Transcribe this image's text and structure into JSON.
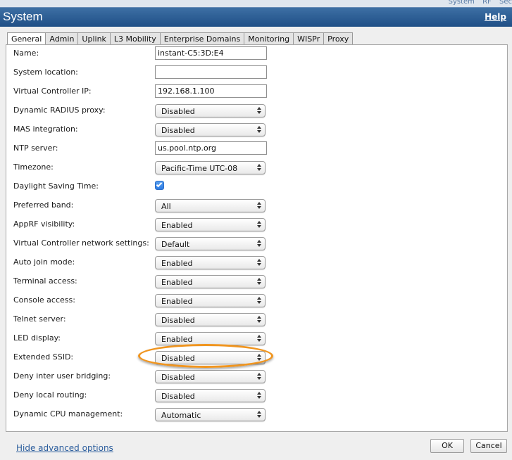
{
  "background_nav": [
    "System",
    "RF",
    "Sec"
  ],
  "window": {
    "title": "System",
    "help_link": "Help"
  },
  "tabs": [
    {
      "label": "General",
      "active": true
    },
    {
      "label": "Admin",
      "active": false
    },
    {
      "label": "Uplink",
      "active": false
    },
    {
      "label": "L3 Mobility",
      "active": false
    },
    {
      "label": "Enterprise Domains",
      "active": false
    },
    {
      "label": "Monitoring",
      "active": false
    },
    {
      "label": "WISPr",
      "active": false
    },
    {
      "label": "Proxy",
      "active": false
    }
  ],
  "form": {
    "name": {
      "label": "Name:",
      "value": "instant-C5:3D:E4"
    },
    "system_location": {
      "label": "System location:",
      "value": ""
    },
    "virtual_controller_ip": {
      "label": "Virtual Controller IP:",
      "value": "192.168.1.100"
    },
    "dynamic_radius_proxy": {
      "label": "Dynamic RADIUS proxy:",
      "value": "Disabled"
    },
    "mas_integration": {
      "label": "MAS integration:",
      "value": "Disabled"
    },
    "ntp_server": {
      "label": "NTP server:",
      "value": "us.pool.ntp.org"
    },
    "timezone": {
      "label": "Timezone:",
      "value": "Pacific-Time UTC-08"
    },
    "daylight_saving_time": {
      "label": "Daylight Saving Time:",
      "checked": true
    },
    "preferred_band": {
      "label": "Preferred band:",
      "value": "All"
    },
    "apprf_visibility": {
      "label": "AppRF visibility:",
      "value": "Enabled"
    },
    "vc_network_settings": {
      "label": "Virtual Controller network settings:",
      "value": "Default"
    },
    "auto_join_mode": {
      "label": "Auto join mode:",
      "value": "Enabled"
    },
    "terminal_access": {
      "label": "Terminal access:",
      "value": "Enabled"
    },
    "console_access": {
      "label": "Console access:",
      "value": "Enabled"
    },
    "telnet_server": {
      "label": "Telnet server:",
      "value": "Disabled"
    },
    "led_display": {
      "label": "LED display:",
      "value": "Enabled"
    },
    "extended_ssid": {
      "label": "Extended SSID:",
      "value": "Disabled"
    },
    "deny_inter_user_bridging": {
      "label": "Deny inter user bridging:",
      "value": "Disabled"
    },
    "deny_local_routing": {
      "label": "Deny local routing:",
      "value": "Disabled"
    },
    "dynamic_cpu_management": {
      "label": "Dynamic CPU management:",
      "value": "Automatic"
    }
  },
  "footer": {
    "hide_advanced": "Hide advanced options",
    "ok": "OK",
    "cancel": "Cancel"
  },
  "colors": {
    "titlebar": "#2a5a93",
    "highlight": "#f0951f",
    "link": "#2a5c9c"
  }
}
